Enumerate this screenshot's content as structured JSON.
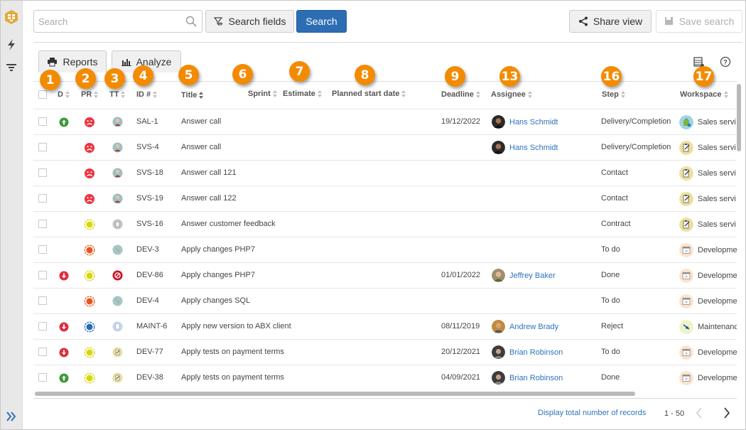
{
  "toolbar": {
    "search_placeholder": "Search",
    "search_value": "",
    "search_fields_label": "Search fields",
    "search_label": "Search",
    "share_view_label": "Share view",
    "save_search_label": "Save search",
    "reports_label": "Reports",
    "analyze_label": "Analyze"
  },
  "sidebar": {
    "icons": [
      "app-logo-icon",
      "bolt-icon",
      "filter-icon",
      "expand-icon"
    ]
  },
  "columns": [
    {
      "key": "d",
      "label": "D",
      "badge": "1"
    },
    {
      "key": "pr",
      "label": "PR",
      "badge": "2"
    },
    {
      "key": "tt",
      "label": "TT",
      "badge": "3"
    },
    {
      "key": "id",
      "label": "ID #",
      "badge": "4"
    },
    {
      "key": "title",
      "label": "Title",
      "badge": "5"
    },
    {
      "key": "sprint",
      "label": "Sprint",
      "badge": "6"
    },
    {
      "key": "estimate",
      "label": "Estimate",
      "badge": "7"
    },
    {
      "key": "planned_start",
      "label": "Planned start date",
      "badge": "8"
    },
    {
      "key": "deadline",
      "label": "Deadline",
      "badge": "9"
    },
    {
      "key": "assignee",
      "label": "Assignee",
      "badge": "13"
    },
    {
      "key": "step",
      "label": "Step",
      "badge": "16"
    },
    {
      "key": "workspace",
      "label": "Workspace",
      "badge": "17"
    }
  ],
  "rows": [
    {
      "d": "up",
      "pr": "sad-red",
      "tt": "person",
      "id": "SAL-1",
      "title": "Answer call",
      "deadline": "19/12/2022",
      "assignee": "Hans Schmidt",
      "avatar": "dark",
      "step": "Delivery/Completion",
      "ws_icon": "bag",
      "workspace": "Sales servi"
    },
    {
      "d": "",
      "pr": "sad-red",
      "tt": "person",
      "id": "SVS-4",
      "title": "Answer call",
      "deadline": "",
      "assignee": "Hans Schmidt",
      "avatar": "dark",
      "step": "Delivery/Completion",
      "ws_icon": "clipboard",
      "workspace": "Sales servi"
    },
    {
      "d": "",
      "pr": "sad-red",
      "tt": "person",
      "id": "SVS-18",
      "title": "Answer call 121",
      "deadline": "",
      "assignee": "",
      "avatar": "",
      "step": "Contact",
      "ws_icon": "clipboard",
      "workspace": "Sales servi"
    },
    {
      "d": "",
      "pr": "sad-red",
      "tt": "person",
      "id": "SVS-19",
      "title": "Answer call 122",
      "deadline": "",
      "assignee": "",
      "avatar": "",
      "step": "Contact",
      "ws_icon": "clipboard",
      "workspace": "Sales servi"
    },
    {
      "d": "",
      "pr": "ring-yellow",
      "tt": "doc-grey",
      "id": "SVS-16",
      "title": "Answer customer feedback",
      "deadline": "",
      "assignee": "",
      "avatar": "",
      "step": "Contract",
      "ws_icon": "clipboard",
      "workspace": "Sales servi"
    },
    {
      "d": "",
      "pr": "ring-orange",
      "tt": "tools",
      "id": "DEV-3",
      "title": "Apply changes PHP7",
      "deadline": "",
      "assignee": "",
      "avatar": "",
      "step": "To do",
      "ws_icon": "window",
      "workspace": "Developme"
    },
    {
      "d": "down",
      "pr": "ring-yellow",
      "tt": "blocked",
      "id": "DEV-86",
      "title": "Apply changes PHP7",
      "deadline": "01/01/2022",
      "assignee": "Jeffrey Baker",
      "avatar": "light",
      "step": "Done",
      "ws_icon": "window",
      "workspace": "Developme"
    },
    {
      "d": "",
      "pr": "ring-orange",
      "tt": "tools",
      "id": "DEV-4",
      "title": "Apply changes SQL",
      "deadline": "",
      "assignee": "",
      "avatar": "",
      "step": "To do",
      "ws_icon": "window",
      "workspace": "Developme"
    },
    {
      "d": "down",
      "pr": "ring-blue",
      "tt": "page",
      "id": "MAINT-6",
      "title": "Apply new version to ABX client",
      "deadline": "08/11/2019",
      "assignee": "Andrew Brady",
      "avatar": "mid",
      "step": "Reject",
      "ws_icon": "wrench",
      "workspace": "Maintenanc"
    },
    {
      "d": "down",
      "pr": "ring-yellow",
      "tt": "clip-small",
      "id": "DEV-77",
      "title": "Apply tests on payment terms",
      "deadline": "20/12/2021",
      "assignee": "Brian Robinson",
      "avatar": "dark2",
      "step": "To do",
      "ws_icon": "window",
      "workspace": "Developme"
    },
    {
      "d": "up",
      "pr": "ring-yellow",
      "tt": "clip-small",
      "id": "DEV-38",
      "title": "Apply tests on payment terms",
      "deadline": "04/09/2021",
      "assignee": "Brian Robinson",
      "avatar": "dark2",
      "step": "Done",
      "ws_icon": "window",
      "workspace": "Developme"
    }
  ],
  "footer": {
    "total_link": "Display total number of records",
    "range": "1 - 50"
  },
  "colors": {
    "accent": "#2d6db3",
    "link": "#2d73bd",
    "badge": "#f38b00"
  }
}
